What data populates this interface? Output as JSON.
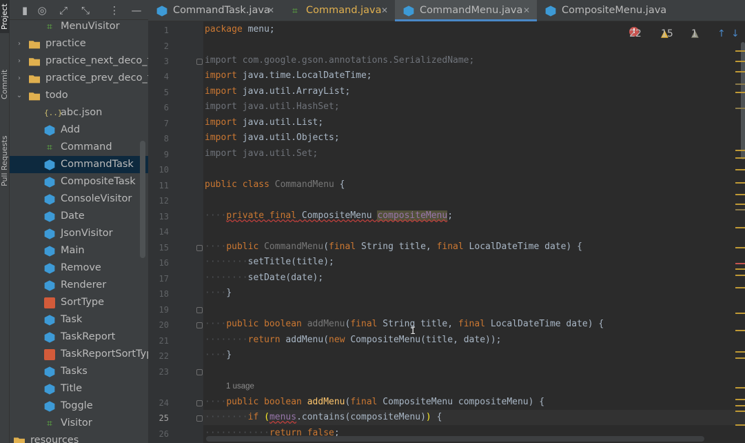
{
  "tool_strip": {
    "project": "Project",
    "commit": "Commit",
    "pull_requests": "Pull Requests"
  },
  "project_tree": [
    {
      "label": "MenuVisitor",
      "icon": "interface-icon",
      "depth": 2,
      "arrow": ""
    },
    {
      "label": "practice",
      "icon": "folder-icon",
      "depth": 1,
      "arrow": "›"
    },
    {
      "label": "practice_next_deco_fo",
      "icon": "folder-icon",
      "depth": 1,
      "arrow": "›"
    },
    {
      "label": "practice_prev_deco_fo",
      "icon": "folder-icon",
      "depth": 1,
      "arrow": "›"
    },
    {
      "label": "todo",
      "icon": "folder-icon",
      "depth": 1,
      "arrow": "⌄"
    },
    {
      "label": "abc.json",
      "icon": "json-icon",
      "depth": 2,
      "arrow": ""
    },
    {
      "label": "Add",
      "icon": "class-icon",
      "depth": 2,
      "arrow": ""
    },
    {
      "label": "Command",
      "icon": "interface-icon",
      "depth": 2,
      "arrow": ""
    },
    {
      "label": "CommandTask",
      "icon": "class-icon",
      "depth": 2,
      "arrow": "",
      "selected": true
    },
    {
      "label": "CompositeTask",
      "icon": "class-icon",
      "depth": 2,
      "arrow": ""
    },
    {
      "label": "ConsoleVisitor",
      "icon": "class-icon",
      "depth": 2,
      "arrow": ""
    },
    {
      "label": "Date",
      "icon": "class-icon",
      "depth": 2,
      "arrow": ""
    },
    {
      "label": "JsonVisitor",
      "icon": "class-icon",
      "depth": 2,
      "arrow": ""
    },
    {
      "label": "Main",
      "icon": "class-icon",
      "depth": 2,
      "arrow": ""
    },
    {
      "label": "Remove",
      "icon": "class-icon",
      "depth": 2,
      "arrow": ""
    },
    {
      "label": "Renderer",
      "icon": "class-icon",
      "depth": 2,
      "arrow": ""
    },
    {
      "label": "SortType",
      "icon": "enum-icon",
      "depth": 2,
      "arrow": ""
    },
    {
      "label": "Task",
      "icon": "class-icon",
      "depth": 2,
      "arrow": ""
    },
    {
      "label": "TaskReport",
      "icon": "class-icon",
      "depth": 2,
      "arrow": ""
    },
    {
      "label": "TaskReportSortTyp",
      "icon": "enum-icon",
      "depth": 2,
      "arrow": ""
    },
    {
      "label": "Tasks",
      "icon": "class-icon",
      "depth": 2,
      "arrow": ""
    },
    {
      "label": "Title",
      "icon": "class-icon",
      "depth": 2,
      "arrow": ""
    },
    {
      "label": "Toggle",
      "icon": "class-icon",
      "depth": 2,
      "arrow": ""
    },
    {
      "label": "Visitor",
      "icon": "interface-icon",
      "depth": 2,
      "arrow": ""
    },
    {
      "label": "resources",
      "icon": "folder-icon",
      "depth": 0,
      "arrow": ""
    }
  ],
  "tabs": [
    {
      "label": "CommandTask.java",
      "icon": "class-icon",
      "active": false
    },
    {
      "label": "Command.java",
      "icon": "interface-icon",
      "active": false
    },
    {
      "label": "CommandMenu.java",
      "icon": "class-icon",
      "active": true
    },
    {
      "label": "CompositeMenu.java",
      "icon": "class-icon",
      "active": false
    }
  ],
  "tab_close": "✕",
  "inspections": {
    "errors": "22",
    "warnings": "15",
    "weak_warnings": "1"
  },
  "usage_hint": "1 usage",
  "line_numbers": [
    "1",
    "2",
    "3",
    "4",
    "5",
    "6",
    "7",
    "8",
    "9",
    "10",
    "11",
    "12",
    "13",
    "14",
    "15",
    "16",
    "17",
    "18",
    "19",
    "20",
    "21",
    "22",
    "23",
    "24",
    "25",
    "26"
  ],
  "current_line": "25",
  "colors": {
    "background": "#2b2b2b",
    "keyword": "#cc7832",
    "field": "#9876aa",
    "method": "#ffc66d",
    "accent": "#4a88c7"
  }
}
